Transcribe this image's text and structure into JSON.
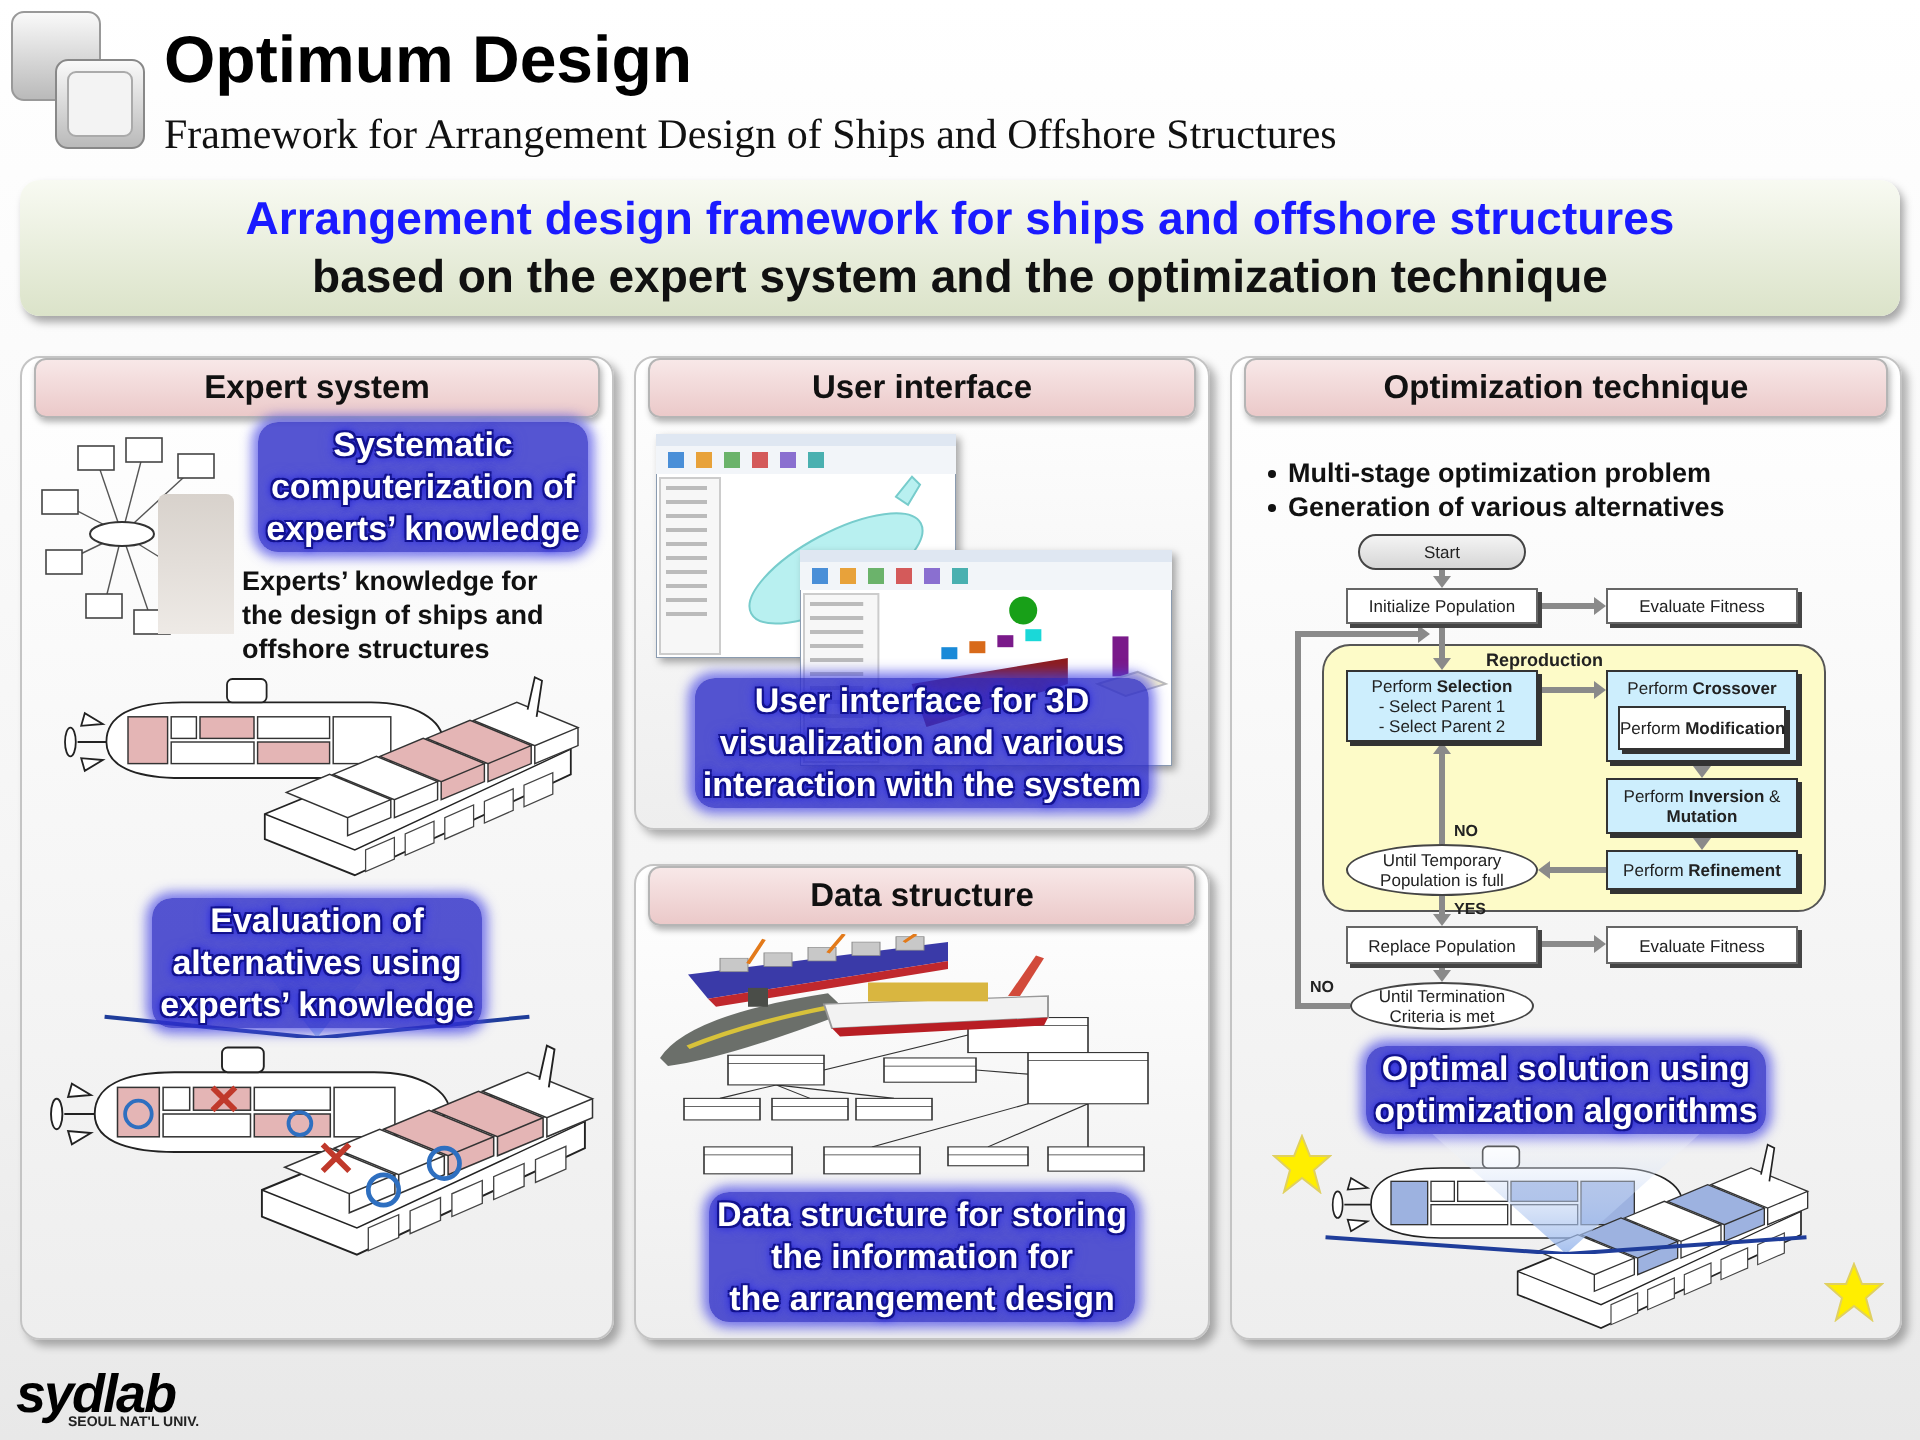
{
  "header": {
    "title": "Optimum Design",
    "subtitle": "Framework for Arrangement Design of Ships and Offshore Structures"
  },
  "banner": {
    "headline": "Arrangement design framework for ships and offshore structures",
    "subline": "based on **the expert system** and **the optimization technique**"
  },
  "expert_system": {
    "title": "Expert system",
    "callout": [
      "Systematic",
      "computerization of",
      "experts’ knowledge"
    ],
    "description": [
      "Experts’ knowledge for",
      "the design of ships and",
      "offshore structures"
    ],
    "evaluation_callout": [
      "Evaluation of",
      "alternatives using",
      "experts’ knowledge"
    ]
  },
  "user_interface": {
    "title": "User interface",
    "callout": [
      "User interface for 3D",
      "visualization and various",
      "interaction with the system"
    ]
  },
  "data_structure": {
    "title": "Data structure",
    "callout": [
      "Data structure for storing",
      "the information for",
      "the arrangement design"
    ]
  },
  "optimization": {
    "title": "Optimization technique",
    "bullets": [
      "Multi-stage optimization problem",
      "Generation of various alternatives"
    ],
    "flowchart": {
      "group_label": "Reproduction",
      "nodes": [
        {
          "kind": "terminal",
          "lines": [
            "Start"
          ]
        },
        {
          "kind": "process",
          "lines": [
            "Initialize Population"
          ]
        },
        {
          "kind": "process",
          "lines": [
            "Evaluate Fitness"
          ]
        },
        {
          "kind": "highlight",
          "lines": [
            "Perform **Selection**",
            "- Select Parent 1",
            "- Select Parent 2"
          ]
        },
        {
          "kind": "highlight",
          "lines": [
            "Perform **Crossover**"
          ]
        },
        {
          "kind": "subprocess",
          "lines": [
            "Perform **Modification**"
          ]
        },
        {
          "kind": "highlight",
          "lines": [
            "Perform **Inversion** &",
            "**Mutation**"
          ]
        },
        {
          "kind": "decision",
          "lines": [
            "Until Temporary",
            "Population is full"
          ]
        },
        {
          "kind": "highlight",
          "lines": [
            "Perform **Refinement**"
          ]
        },
        {
          "kind": "process",
          "lines": [
            "Replace Population"
          ]
        },
        {
          "kind": "process",
          "lines": [
            "Evaluate Fitness"
          ]
        },
        {
          "kind": "decision",
          "lines": [
            "Until Termination",
            "Criteria is met"
          ]
        }
      ],
      "labels": [
        "NO",
        "YES",
        "NO"
      ]
    },
    "callout": [
      "Optimal solution using",
      "optimization algorithms"
    ]
  },
  "footer": {
    "logo": "sydlab",
    "caption": "SEOUL NAT'L UNIV."
  }
}
